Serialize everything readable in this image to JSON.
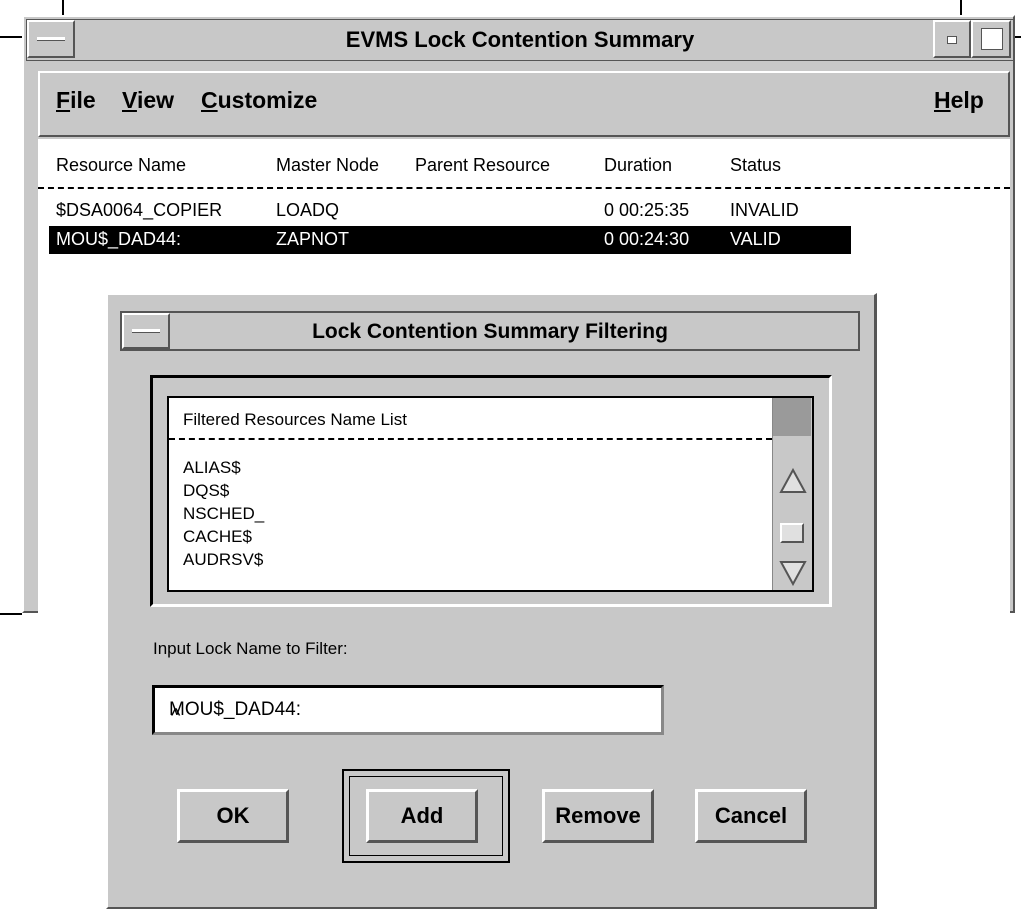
{
  "main_window": {
    "title": "EVMS Lock Contention Summary",
    "menu": {
      "file": {
        "mnemonic": "F",
        "rest": "ile"
      },
      "view": {
        "mnemonic": "V",
        "rest": "iew"
      },
      "customize": {
        "mnemonic": "C",
        "rest": "ustomize"
      },
      "help": {
        "mnemonic": "H",
        "rest": "elp"
      }
    },
    "columns": [
      "Resource Name",
      "Master Node",
      "Parent Resource",
      "Duration",
      "Status"
    ],
    "rows": [
      {
        "resource": "$DSA0064_COPIER",
        "master": "LOADQ",
        "parent": "",
        "duration": "0 00:25:35",
        "status": "INVALID",
        "selected": false
      },
      {
        "resource": "MOU$_DAD44:",
        "master": "ZAPNOT",
        "parent": "",
        "duration": "0 00:24:30",
        "status": "VALID",
        "selected": true
      }
    ]
  },
  "dialog": {
    "title": "Lock Contention Summary Filtering",
    "list_header": "Filtered Resources Name List",
    "list_items": [
      "ALIAS$",
      "DQS$",
      "NSCHED_",
      "CACHE$",
      "AUDRSV$"
    ],
    "input_label": "Input Lock Name to Filter:",
    "input_value": "MOU$_DAD44:",
    "buttons": {
      "ok": "OK",
      "add": "Add",
      "remove": "Remove",
      "cancel": "Cancel"
    }
  },
  "colors": {
    "window_bg": "#c8c8c8",
    "selection_bg": "#000000",
    "selection_fg": "#ffffff"
  },
  "icons": [
    "window-menu-icon",
    "minimize-icon",
    "maximize-icon",
    "scroll-up-arrow-icon",
    "scroll-down-arrow-icon"
  ]
}
